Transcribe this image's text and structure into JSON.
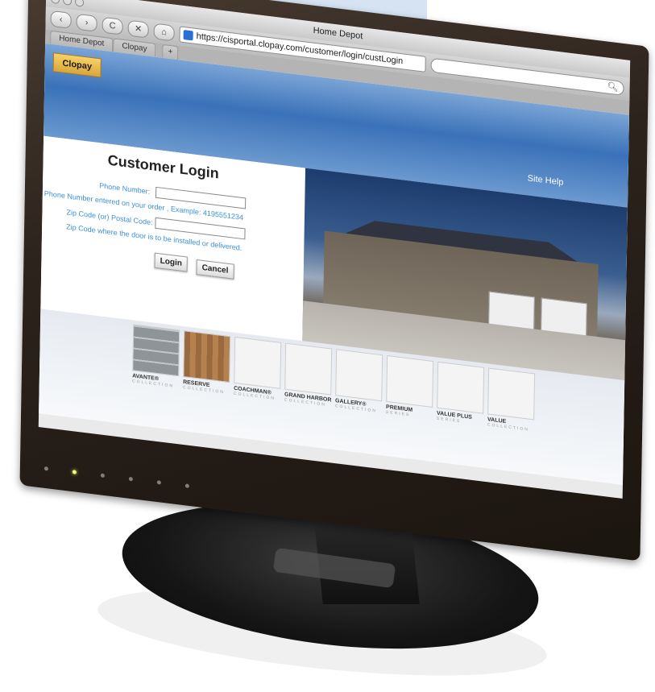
{
  "browser": {
    "window_title": "Home Depot",
    "url": "https://cisportal.clopay.com/customer/login/custLogin",
    "tabs": [
      {
        "label": "Home Depot"
      },
      {
        "label": "Clopay"
      }
    ],
    "new_tab_label": "+",
    "search_placeholder": "",
    "nav": {
      "back": "‹",
      "forward": "›",
      "reload": "C",
      "stop": "✕",
      "home": "⌂"
    }
  },
  "site": {
    "logo_text": "Clopay",
    "site_help": "Site Help"
  },
  "login": {
    "title": "Customer Login",
    "phone_label": "Phone Number:",
    "phone_hint": "Phone Number entered on your order , Example: 4195551234",
    "zip_label": "Zip Code (or) Postal Code:",
    "zip_hint": "Zip Code where the door is to be installed or delivered.",
    "login_button": "Login",
    "cancel_button": "Cancel"
  },
  "collections": [
    {
      "name": "AVANTE®",
      "sub": "COLLECTION",
      "style": "avante"
    },
    {
      "name": "RESERVE",
      "sub": "COLLECTION",
      "style": "reserve"
    },
    {
      "name": "COACHMAN®",
      "sub": "COLLECTION",
      "style": "plain"
    },
    {
      "name": "GRAND HARBOR",
      "sub": "COLLECTION",
      "style": "plain"
    },
    {
      "name": "GALLERY®",
      "sub": "COLLECTION",
      "style": "plain"
    },
    {
      "name": "PREMIUM",
      "sub": "SERIES",
      "style": "plain"
    },
    {
      "name": "VALUE PLUS",
      "sub": "SERIES",
      "style": "plain"
    },
    {
      "name": "VALUE",
      "sub": "COLLECTION",
      "style": "plain"
    }
  ],
  "colors": {
    "accent_blue": "#3b8fd6",
    "header_blue": "#3a71b8",
    "monitor_bezel": "#2c231c"
  }
}
